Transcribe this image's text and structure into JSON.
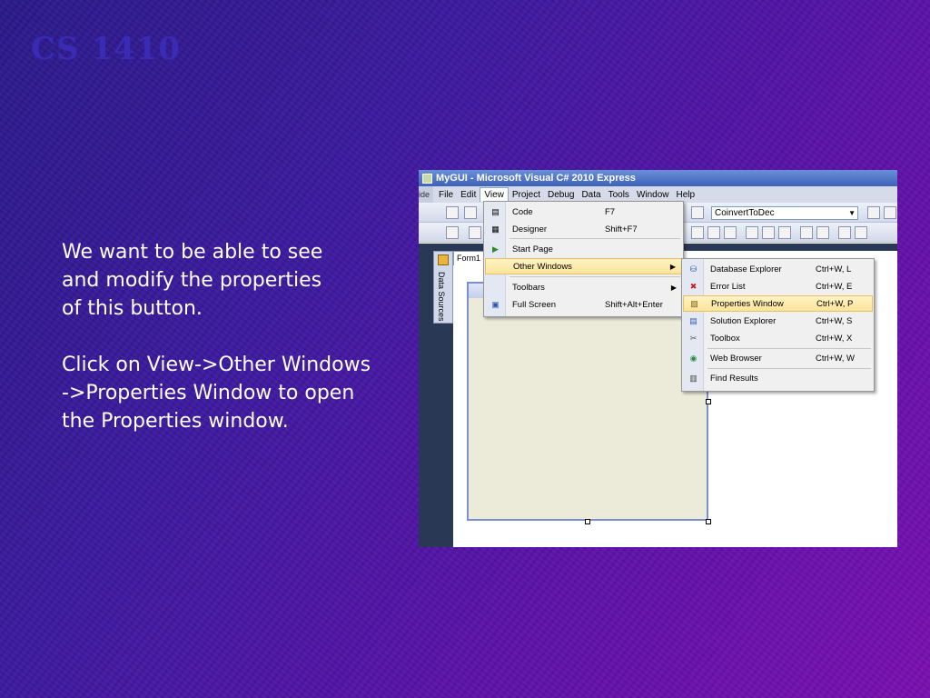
{
  "slide": {
    "title": "CS 1410",
    "paragraph1": "We want to be able to see\nand modify the properties\nof this button.",
    "paragraph2": "Click on View->Other Windows\n->Properties Window to open\nthe Properties window."
  },
  "app": {
    "title": "MyGUI - Microsoft Visual C# 2010 Express",
    "left_stub": "ide",
    "menu": [
      "File",
      "Edit",
      "View",
      "Project",
      "Debug",
      "Data",
      "Tools",
      "Window",
      "Help"
    ],
    "active_menu": "View",
    "combo_value": "CoinvertToDec",
    "side_tab": "Data Sources",
    "doc_tab": "Form1"
  },
  "view_menu": [
    {
      "icon": "code-icon",
      "label": "Code",
      "shortcut": "F7"
    },
    {
      "icon": "designer-icon",
      "label": "Designer",
      "shortcut": "Shift+F7"
    },
    {
      "icon": "start-page-icon",
      "label": "Start Page",
      "shortcut": ""
    },
    {
      "icon": "",
      "label": "Other Windows",
      "shortcut": "",
      "submenu": true,
      "highlighted": true
    },
    {
      "icon": "",
      "label": "Toolbars",
      "shortcut": "",
      "submenu": true
    },
    {
      "icon": "full-screen-icon",
      "label": "Full Screen",
      "shortcut": "Shift+Alt+Enter"
    }
  ],
  "other_windows_menu": [
    {
      "icon": "database-explorer-icon",
      "label": "Database Explorer",
      "shortcut": "Ctrl+W, L"
    },
    {
      "icon": "error-list-icon",
      "label": "Error List",
      "shortcut": "Ctrl+W, E"
    },
    {
      "icon": "properties-window-icon",
      "label": "Properties Window",
      "shortcut": "Ctrl+W, P",
      "highlighted": true
    },
    {
      "icon": "solution-explorer-icon",
      "label": "Solution Explorer",
      "shortcut": "Ctrl+W, S"
    },
    {
      "icon": "toolbox-icon",
      "label": "Toolbox",
      "shortcut": "Ctrl+W, X"
    },
    {
      "icon": "web-browser-icon",
      "label": "Web Browser",
      "shortcut": "Ctrl+W, W"
    },
    {
      "icon": "find-results-icon",
      "label": "Find Results",
      "shortcut": ""
    }
  ]
}
